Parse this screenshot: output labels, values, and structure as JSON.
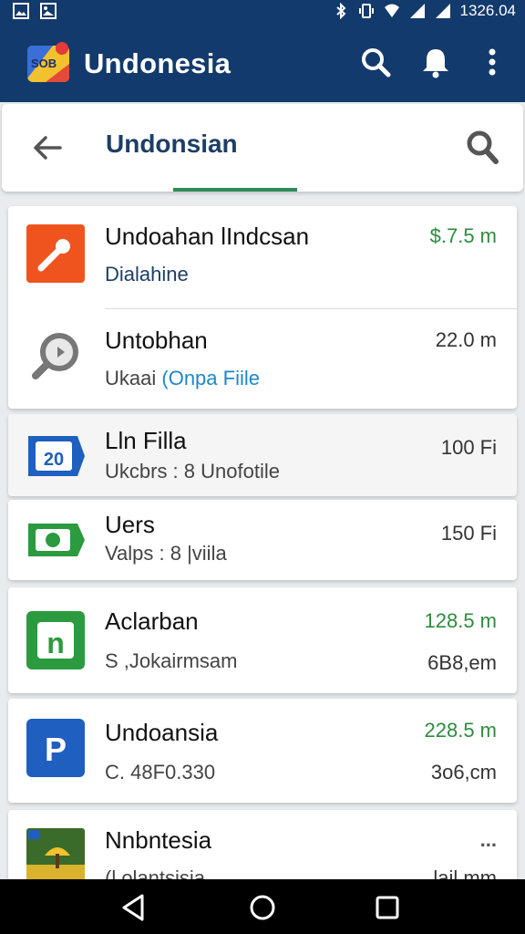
{
  "status_bar": {
    "time": "1326.04",
    "left_icons": [
      "image-icon",
      "image-icon"
    ],
    "right_icons": [
      "bluetooth-icon",
      "vibrate-icon",
      "wifi-icon",
      "signal-icon",
      "signal-icon"
    ]
  },
  "app_bar": {
    "logo_text": "SOB",
    "title": "Undonesia",
    "actions": [
      "search-icon",
      "bell-icon",
      "more-vert-icon"
    ]
  },
  "search": {
    "query": "Undonsian"
  },
  "items": [
    {
      "title": "Undoahan lIndcsan",
      "subtitle": "Dialahine",
      "value": "$.7.5 m",
      "value_color": "#2e8b3e",
      "icon": "wrench-icon",
      "icon_color": "#f0541e"
    },
    {
      "title": "Untobhan",
      "subtitle": "Ukaai",
      "subtitle_link": "(Onpa Fiile",
      "value": "22.0 m",
      "icon": "magnifier-icon"
    },
    {
      "title": "Lln Filla",
      "subtitle": "Ukcbrs : 8 Unofotile",
      "value": "100 Fi",
      "icon": "calendar-icon",
      "icon_label": "20"
    },
    {
      "title": "Uers",
      "subtitle": "Valps : 8 |viila",
      "value": "150 Fi",
      "icon": "cash-icon"
    },
    {
      "title": "Aclarban",
      "subtitle": "S ,Jokairmsam",
      "value": "128.5 m",
      "value_color": "#2e8b3e",
      "value2": "6B8,em",
      "icon": "app-n-icon",
      "icon_letter": "n",
      "icon_color": "#2c9a3e"
    },
    {
      "title": "Undoansia",
      "subtitle": "C. 48F0.330",
      "value": "228.5 m",
      "value_color": "#2e8b3e",
      "value2": "3o6,cm",
      "icon": "app-p-icon",
      "icon_letter": "P",
      "icon_color": "#1f5fbf"
    },
    {
      "title": "Nnbntesia",
      "subtitle": "(l olantsisia",
      "value": "...",
      "value2": "lail mm",
      "icon": "photo-icon"
    }
  ],
  "nav_bar": [
    "back-triangle-icon",
    "home-circle-icon",
    "recents-square-icon"
  ]
}
